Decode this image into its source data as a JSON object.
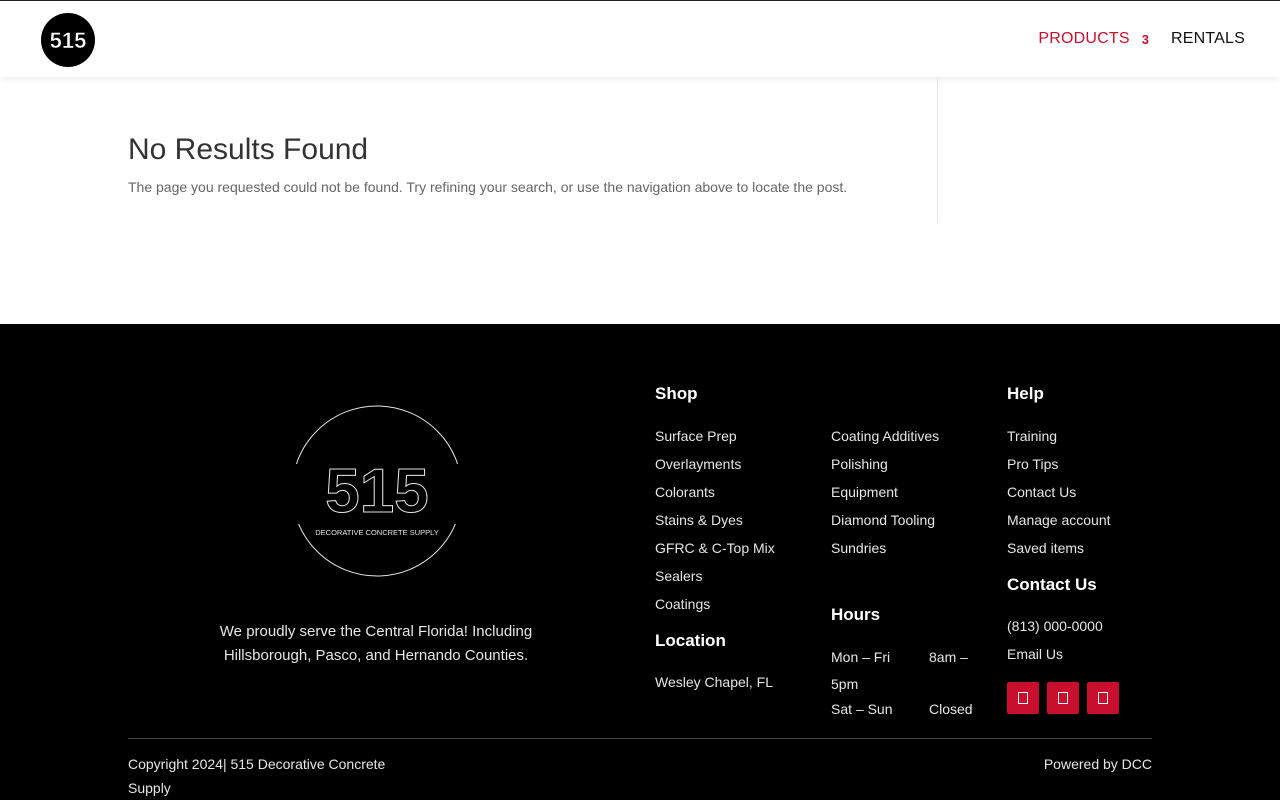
{
  "header": {
    "logo_text": "515",
    "nav": {
      "products_label": "PRODUCTS",
      "products_badge": "3",
      "rentals_label": "RENTALS"
    }
  },
  "main": {
    "title": "No Results Found",
    "message": "The page you requested could not be found. Try refining your search, or use the navigation above to locate the post."
  },
  "footer": {
    "logo_main_text": "515",
    "logo_sub_text": "DECORATIVE CONCRETE SUPPLY",
    "tagline": "We proudly serve the Central Florida! Including Hillsborough, Pasco, and Hernando Counties.",
    "shop": {
      "heading": "Shop",
      "col1": [
        "Surface Prep",
        "Overlayments",
        "Colorants",
        "Stains & Dyes",
        "GFRC & C-Top Mix",
        "Sealers",
        "Coatings"
      ],
      "col2": [
        "Coating Additives",
        "Polishing",
        "Equipment",
        "Diamond Tooling",
        "Sundries"
      ]
    },
    "location": {
      "heading": "Location",
      "value": "Wesley Chapel, FL"
    },
    "hours": {
      "heading": "Hours",
      "weekday_label": "Mon – Fri",
      "weekday_value": "8am – 5pm",
      "weekend_label": "Sat – Sun",
      "weekend_value": "Closed"
    },
    "help": {
      "heading": "Help",
      "items": [
        "Training",
        "Pro Tips",
        "Contact Us",
        "Manage account",
        "Saved items"
      ]
    },
    "contact": {
      "heading": "Contact Us",
      "phone": "(813) 000-0000",
      "email_label": "Email Us"
    },
    "social_icons": [
      "social-icon-1",
      "social-icon-2",
      "social-icon-3"
    ],
    "copyright": "Copyright 2024| 515 Decorative Concrete Supply",
    "powered_by": "Powered by DCC"
  },
  "colors": {
    "accent": "#c8102e",
    "footer_bg": "#000000"
  }
}
